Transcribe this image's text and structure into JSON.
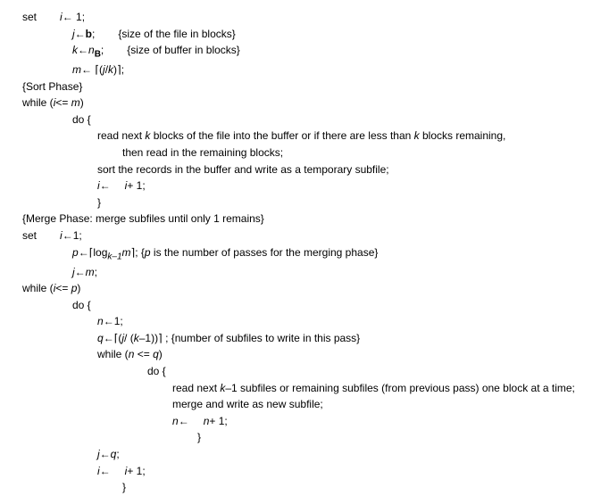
{
  "l1a": "set",
  "l1b": "i",
  "l1c": "← 1;",
  "l2a": "j",
  "l2b": "←",
  "l2c": "b",
  "l2d": ";",
  "l2e": "{size of the file in blocks}",
  "l3a": "k",
  "l3b": "←",
  "l3c": "n",
  "l3d": "B",
  "l3e": ";",
  "l3f": "{size of buffer in blocks}",
  "l4a": "m",
  "l4b": "← ⌈(",
  "l4c": "j",
  "l4d": "/",
  "l4e": "k",
  "l4f": ")⌉;",
  "l5": "{Sort Phase}",
  "l6a": "while (",
  "l6b": "i",
  "l6c": "<= ",
  "l6d": "m",
  "l6e": ")",
  "l7": "do {",
  "l8a": "read next ",
  "l8b": "k",
  "l8c": " blocks of the file into the buffer or if there are less than ",
  "l8d": "k",
  "l8e": " blocks remaining,",
  "l9": "then read in the remaining blocks;",
  "l10": "sort the records in the buffer and write as a temporary subfile;",
  "l11a": "i",
  "l11b": "←",
  "l11c": "i",
  "l11d": "+ 1;",
  "l12": "}",
  "l13": "{Merge Phase: merge subfiles until only 1 remains}",
  "l14a": "set",
  "l14b": "i",
  "l14c": "←1;",
  "l15a": "p",
  "l15b": "←⌈log",
  "l15c": "k–1",
  "l15d": "m",
  "l15e": "⌉;   {",
  "l15f": "p",
  "l15g": " is the number of passes for the merging phase}",
  "l16a": "j",
  "l16b": "←",
  "l16c": "m",
  "l16d": ";",
  "l17a": "while (",
  "l17b": "i",
  "l17c": "<= ",
  "l17d": "p",
  "l17e": ")",
  "l18": "do {",
  "l19a": "n",
  "l19b": "←1;",
  "l20a": "q",
  "l20b": "←⌈(",
  "l20c": "j",
  "l20d": "/ (",
  "l20e": "k",
  "l20f": "–1))⌉ ;   {number of subfiles to write in this pass}",
  "l21a": "while (",
  "l21b": "n",
  "l21c": " <= ",
  "l21d": "q",
  "l21e": ")",
  "l22": "do {",
  "l23a": "read next ",
  "l23b": "k",
  "l23c": "–1 subfiles or remaining subfiles (from previous pass) one block at a time;",
  "l24": "merge and write as new subfile;",
  "l25a": "n",
  "l25b": "←",
  "l25c": "n",
  "l25d": "+ 1;",
  "l26": "}",
  "l27a": "j",
  "l27b": "←",
  "l27c": "q",
  "l27d": ";",
  "l28a": "i",
  "l28b": "←",
  "l28c": "i",
  "l28d": "+ 1;",
  "l29": "}"
}
